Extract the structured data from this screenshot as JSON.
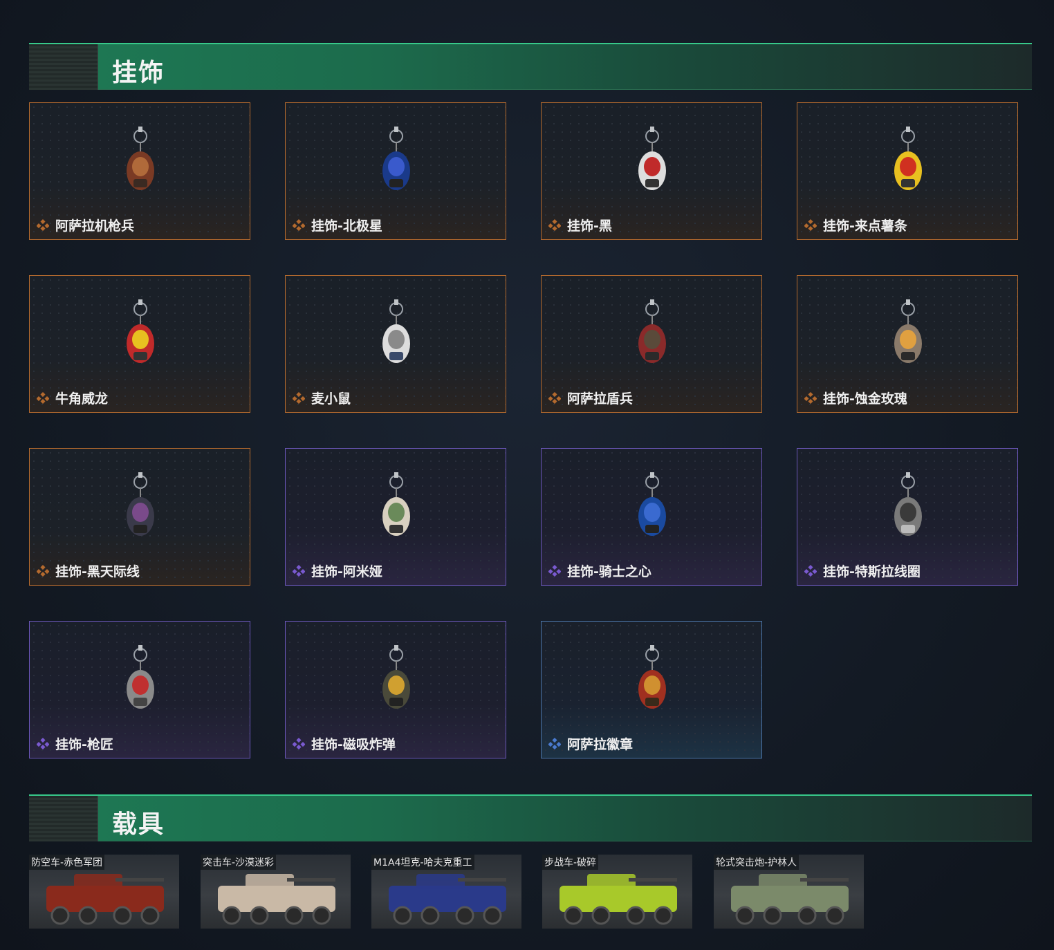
{
  "sections": {
    "pendants_title": "挂饰",
    "vehicles_title": "载具"
  },
  "pendants": [
    {
      "name": "阿萨拉机枪兵",
      "rarity": "orange",
      "art": "soldier-charm-icon"
    },
    {
      "name": "挂饰-北极星",
      "rarity": "orange",
      "art": "polaris-charm-icon"
    },
    {
      "name": "挂饰-黑",
      "rarity": "orange",
      "art": "black-tag-charm-icon"
    },
    {
      "name": "挂饰-来点薯条",
      "rarity": "orange",
      "art": "fries-charm-icon"
    },
    {
      "name": "牛角威龙",
      "rarity": "orange",
      "art": "horned-dragon-charm-icon"
    },
    {
      "name": "麦小鼠",
      "rarity": "orange",
      "art": "mouse-charm-icon"
    },
    {
      "name": "阿萨拉盾兵",
      "rarity": "orange",
      "art": "shield-soldier-charm-icon"
    },
    {
      "name": "挂饰-蚀金玫瑰",
      "rarity": "orange",
      "art": "gold-rose-charm-icon"
    },
    {
      "name": "挂饰-黑天际线",
      "rarity": "orange",
      "art": "skyline-charm-icon"
    },
    {
      "name": "挂饰-阿米娅",
      "rarity": "purple",
      "art": "amiya-charm-icon"
    },
    {
      "name": "挂饰-骑士之心",
      "rarity": "purple",
      "art": "knight-heart-charm-icon"
    },
    {
      "name": "挂饰-特斯拉线圈",
      "rarity": "purple",
      "art": "tesla-coil-charm-icon"
    },
    {
      "name": "挂饰-枪匠",
      "rarity": "purple",
      "art": "gunsmith-charm-icon"
    },
    {
      "name": "挂饰-磁吸炸弹",
      "rarity": "purple",
      "art": "magnetic-bomb-charm-icon"
    },
    {
      "name": "阿萨拉徽章",
      "rarity": "blue",
      "art": "asala-badge-charm-icon"
    }
  ],
  "vehicles": [
    {
      "name": "防空车-赤色军团",
      "art": "anti-air-vehicle-icon",
      "camo": "#8a2a1c"
    },
    {
      "name": "突击车-沙漠迷彩",
      "art": "assault-vehicle-icon",
      "camo": "#c9b9a6"
    },
    {
      "name": "M1A4坦克-哈夫克重工",
      "art": "tank-icon",
      "camo": "#2a3a8a"
    },
    {
      "name": "步战车-破碎",
      "art": "ifv-vehicle-icon",
      "camo": "#a8c92a"
    },
    {
      "name": "轮式突击炮-护林人",
      "art": "wheeled-assault-gun-icon",
      "camo": "#7b8a6a"
    }
  ],
  "colors": {
    "orange": "#b46a2e",
    "purple": "#7a5ad0",
    "blue": "#4a7ad0",
    "header_green": "#1e7a55"
  }
}
